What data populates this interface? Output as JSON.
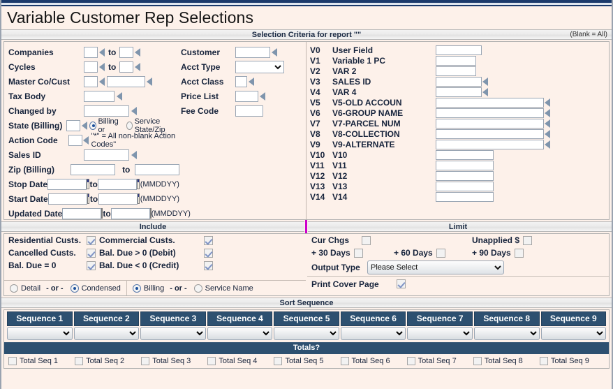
{
  "window": {
    "title": "Variable Customer Rep Selections"
  },
  "criteria": {
    "header": "Selection Criteria for report \"\"",
    "blank_note": "(Blank = All)",
    "left_fields": [
      {
        "label": "Companies",
        "type": "range-sm",
        "value1": "",
        "value2": "",
        "to": "to"
      },
      {
        "label": "Cycles",
        "type": "range-sm",
        "value1": "",
        "value2": "",
        "to": "to"
      },
      {
        "label": "Master Co/Cust",
        "type": "pair",
        "value1": "",
        "value2": ""
      },
      {
        "label": "Tax Body",
        "type": "single-md",
        "value1": ""
      },
      {
        "label": "Changed by",
        "type": "single-lg",
        "value1": ""
      },
      {
        "label": "State (Billing)",
        "type": "state",
        "value1": ""
      },
      {
        "label": "Action Code",
        "type": "action",
        "value1": ""
      },
      {
        "label": "Sales ID",
        "type": "single-lg",
        "value1": ""
      },
      {
        "label": "Zip (Billing)",
        "type": "range-lg",
        "value1": "",
        "value2": "",
        "to": "to"
      },
      {
        "label": "Stop Date",
        "type": "date",
        "value1": "",
        "value2": "",
        "to": "to",
        "format": "(MMDDYY)"
      },
      {
        "label": "Start Date",
        "type": "date",
        "value1": "",
        "value2": "",
        "to": "to",
        "format": "(MMDDYY)"
      },
      {
        "label": "Updated Date",
        "type": "date",
        "value1": "",
        "value2": "",
        "to": "to",
        "format": "(MMDDYY)"
      }
    ],
    "state_options": {
      "billing_label": "Billing or",
      "service_label": "Service State/Zip",
      "selected": "billing"
    },
    "action_hint": "\"*\" = All non-blank Action Codes\"",
    "mid_fields": [
      {
        "label": "Customer",
        "type": "single-md",
        "value": ""
      },
      {
        "label": "Acct Type",
        "type": "select",
        "value": "",
        "options": [
          ""
        ]
      },
      {
        "label": "Acct Class",
        "type": "single-xs",
        "value": ""
      },
      {
        "label": "Price List",
        "type": "single-sm",
        "value": ""
      },
      {
        "label": "Fee Code",
        "type": "single-sm-noarrow",
        "value": ""
      }
    ],
    "variables": [
      {
        "key": "V0",
        "name": "User Field",
        "value": "",
        "width": "sm",
        "arrow": false
      },
      {
        "key": "V1",
        "name": "Variable 1 PC",
        "value": "",
        "width": "xs",
        "arrow": false
      },
      {
        "key": "V2",
        "name": "VAR 2",
        "value": "",
        "width": "xs",
        "arrow": false
      },
      {
        "key": "V3",
        "name": "SALES ID",
        "value": "",
        "width": "md",
        "arrow": true
      },
      {
        "key": "V4",
        "name": "VAR 4",
        "value": "",
        "width": "md",
        "arrow": true
      },
      {
        "key": "V5",
        "name": "V5-OLD ACCOUN",
        "value": "",
        "width": "lg",
        "arrow": true
      },
      {
        "key": "V6",
        "name": "V6-GROUP NAME",
        "value": "",
        "width": "lg",
        "arrow": true
      },
      {
        "key": "V7",
        "name": "V7-PARCEL NUM",
        "value": "",
        "width": "lg",
        "arrow": true
      },
      {
        "key": "V8",
        "name": "V8-COLLECTION",
        "value": "",
        "width": "lg",
        "arrow": true
      },
      {
        "key": "V9",
        "name": "V9-ALTERNATE",
        "value": "",
        "width": "lg",
        "arrow": true
      },
      {
        "key": "V10",
        "name": "V10",
        "value": "",
        "width": "md2",
        "arrow": false
      },
      {
        "key": "V11",
        "name": "V11",
        "value": "",
        "width": "md2",
        "arrow": false
      },
      {
        "key": "V12",
        "name": "V12",
        "value": "",
        "width": "md2",
        "arrow": false
      },
      {
        "key": "V13",
        "name": "V13",
        "value": "",
        "width": "md2",
        "arrow": false
      },
      {
        "key": "V14",
        "name": "V14",
        "value": "",
        "width": "md2",
        "arrow": false
      }
    ]
  },
  "include": {
    "header": "Include",
    "checkboxes": [
      {
        "label": "Residential Custs.",
        "checked": true
      },
      {
        "label": "Commercial Custs.",
        "checked": true
      },
      {
        "label": "Cancelled Custs.",
        "checked": true
      },
      {
        "label": "Bal. Due > 0 (Debit)",
        "checked": true
      },
      {
        "label": "Bal. Due = 0",
        "checked": true
      },
      {
        "label": "Bal. Due < 0 (Credit)",
        "checked": true
      }
    ],
    "detail_group": {
      "detail": "Detail",
      "or": "- or -",
      "condensed": "Condensed",
      "selected": "condensed"
    },
    "name_group": {
      "billing": "Billing",
      "or": "- or -",
      "service": "Service Name",
      "selected": "billing"
    }
  },
  "limit": {
    "header": "Limit",
    "checkboxes": [
      {
        "label": "Cur Chgs",
        "checked": false
      },
      {
        "label": "Unapplied $",
        "checked": false
      },
      {
        "label": "+ 30 Days",
        "checked": false
      },
      {
        "label": "+ 60 Days",
        "checked": false
      },
      {
        "label": "+ 90 Days",
        "checked": false
      }
    ],
    "output_type": {
      "label": "Output Type",
      "value": "Please Select",
      "options": [
        "Please Select"
      ]
    },
    "print_cover": {
      "label": "Print Cover Page",
      "checked": true
    }
  },
  "sort": {
    "header": "Sort Sequence",
    "columns": [
      {
        "header": "Sequence 1",
        "value": "",
        "total_label": "Total Seq 1",
        "total_checked": false
      },
      {
        "header": "Sequence 2",
        "value": "",
        "total_label": "Total Seq 2",
        "total_checked": false
      },
      {
        "header": "Sequence 3",
        "value": "",
        "total_label": "Total Seq 3",
        "total_checked": false
      },
      {
        "header": "Sequence 4",
        "value": "",
        "total_label": "Total Seq 4",
        "total_checked": false
      },
      {
        "header": "Sequence 5",
        "value": "",
        "total_label": "Total Seq 5",
        "total_checked": false
      },
      {
        "header": "Sequence 6",
        "value": "",
        "total_label": "Total Seq 6",
        "total_checked": false
      },
      {
        "header": "Sequence 7",
        "value": "",
        "total_label": "Total Seq 7",
        "total_checked": false
      },
      {
        "header": "Sequence 8",
        "value": "",
        "total_label": "Total Seq 8",
        "total_checked": false
      },
      {
        "header": "Sequence 9",
        "value": "",
        "total_label": "Total Seq 9",
        "total_checked": false
      }
    ],
    "totals_header": "Totals?"
  },
  "colors": {
    "background": "#fdf1ea",
    "header_blue": "#2d5070",
    "divider_magenta": "#cc00cc",
    "titlebar": "#1b3a6b"
  }
}
